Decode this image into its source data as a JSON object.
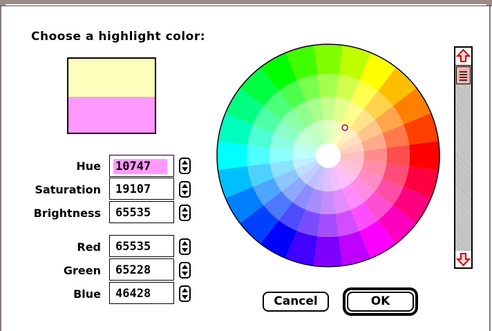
{
  "dialog": {
    "prompt": "Choose a highlight color:"
  },
  "swatch": {
    "new_color": "#fbffbb",
    "original_color": "#ff99ff"
  },
  "hsb": {
    "hue_label": "Hue",
    "hue_value": "10747",
    "saturation_label": "Saturation",
    "saturation_value": "19107",
    "brightness_label": "Brightness",
    "brightness_value": "65535"
  },
  "rgb": {
    "red_label": "Red",
    "red_value": "65535",
    "green_label": "Green",
    "green_value": "65228",
    "blue_label": "Blue",
    "blue_value": "46428"
  },
  "buttons": {
    "cancel_label": "Cancel",
    "ok_label": "OK"
  },
  "brightness_scroll": {
    "level": 1.0
  },
  "icons": {
    "stepper": "up-down-arrows-icon",
    "scroll_up": "arrow-up-icon",
    "scroll_down": "arrow-down-icon",
    "wheel_marker": "circle-marker-icon"
  },
  "colors": {
    "selection_highlight": "#ff99ff",
    "scroll_arrow_accent": "#cc0000",
    "thumb_fill": "#ffb0b0"
  }
}
